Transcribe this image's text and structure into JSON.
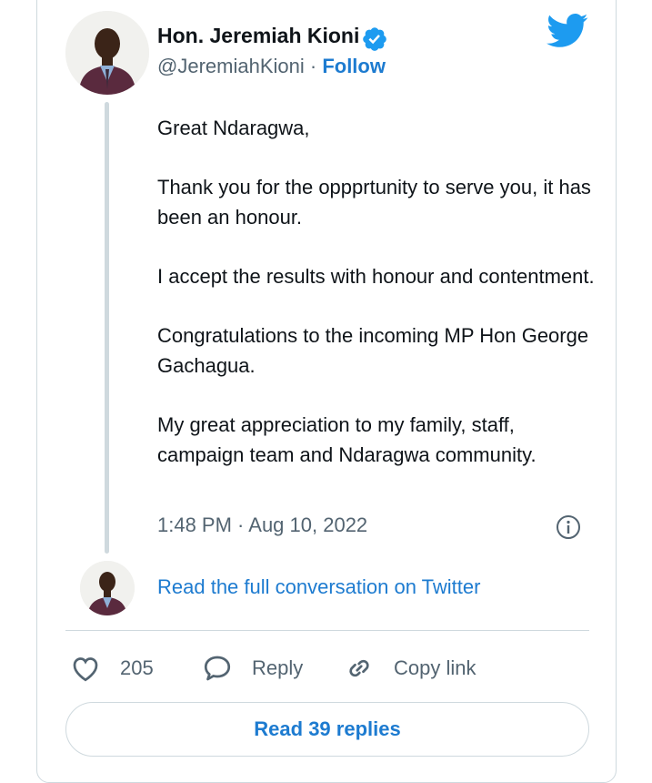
{
  "author": {
    "name": "Hon. Jeremiah Kioni",
    "handle": "@JeremiahKioni",
    "separator": "·",
    "follow_label": "Follow",
    "verified": true
  },
  "tweet": {
    "paragraphs": [
      "Great Ndaragwa,",
      "Thank you for the oppprtunity to serve you, it has been an honour.",
      "I accept the results with honour and contentment.",
      "Congratulations to the incoming MP Hon George Gachagua.",
      "My great appreciation to my family, staff, campaign team and Ndaragwa community."
    ],
    "timestamp": "1:48 PM · Aug 10, 2022"
  },
  "conversation_link": "Read the full conversation on Twitter",
  "actions": {
    "like_count": "205",
    "reply_label": "Reply",
    "copy_label": "Copy link"
  },
  "read_replies_label": "Read 39 replies",
  "icons": {
    "brand": "twitter-bird-icon",
    "verified": "verified-badge-icon",
    "info": "info-icon",
    "like": "heart-icon",
    "reply": "speech-bubble-icon",
    "copy": "link-icon"
  },
  "colors": {
    "accent": "#1d9bf0",
    "link": "#1d7bd0",
    "secondary_text": "#536471",
    "border": "#cfd9de"
  }
}
